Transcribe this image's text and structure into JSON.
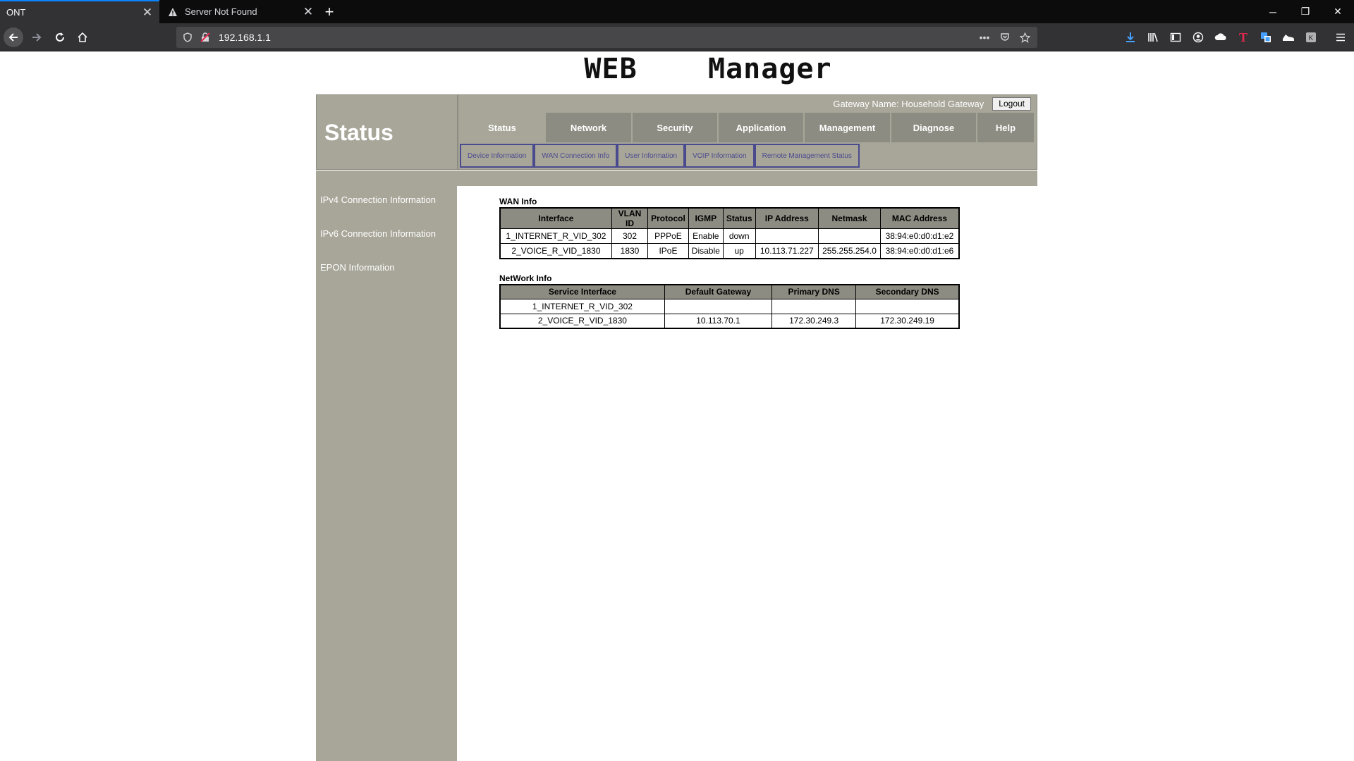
{
  "browser": {
    "tabs": [
      {
        "label": "ONT",
        "active": true
      },
      {
        "label": "Server Not Found",
        "active": false,
        "icon": "warning-icon"
      }
    ],
    "url": "192.168.1.1"
  },
  "site": {
    "title": "WEB    Manager"
  },
  "header": {
    "section_title": "Status",
    "gateway_label": "Gateway Name: Household Gateway",
    "logout_label": "Logout",
    "main_tabs": [
      {
        "label": "Status",
        "active": true
      },
      {
        "label": "Network"
      },
      {
        "label": "Security"
      },
      {
        "label": "Application"
      },
      {
        "label": "Management"
      },
      {
        "label": "Diagnose"
      },
      {
        "label": "Help"
      }
    ],
    "sub_tabs": [
      {
        "label": "Device Information"
      },
      {
        "label": "WAN Connection Info"
      },
      {
        "label": "User Information"
      },
      {
        "label": "VOIP Information"
      },
      {
        "label": "Remote Management Status"
      }
    ]
  },
  "sidebar": {
    "items": [
      {
        "label": "IPv4 Connection Information"
      },
      {
        "label": "IPv6 Connection Information"
      },
      {
        "label": "EPON Information"
      }
    ]
  },
  "wan_info": {
    "title": "WAN Info",
    "columns": [
      "Interface",
      "VLAN ID",
      "Protocol",
      "IGMP",
      "Status",
      "IP Address",
      "Netmask",
      "MAC Address"
    ],
    "rows": [
      [
        "1_INTERNET_R_VID_302",
        "302",
        "PPPoE",
        "Enable",
        "down",
        "",
        "",
        "38:94:e0:d0:d1:e2"
      ],
      [
        "2_VOICE_R_VID_1830",
        "1830",
        "IPoE",
        "Disable",
        "up",
        "10.113.71.227",
        "255.255.254.0",
        "38:94:e0:d0:d1:e6"
      ]
    ]
  },
  "network_info": {
    "title": "NetWork Info",
    "columns": [
      "Service Interface",
      "Default Gateway",
      "Primary DNS",
      "Secondary DNS"
    ],
    "rows": [
      [
        "1_INTERNET_R_VID_302",
        "",
        "",
        ""
      ],
      [
        "2_VOICE_R_VID_1830",
        "10.113.70.1",
        "172.30.249.3",
        "172.30.249.19"
      ]
    ]
  },
  "colors": {
    "nav_bg": "#a8a699",
    "tab_bg": "#8c8c82",
    "subtab_border": "#4a4a8e",
    "browser_accent": "#0a84ff"
  }
}
